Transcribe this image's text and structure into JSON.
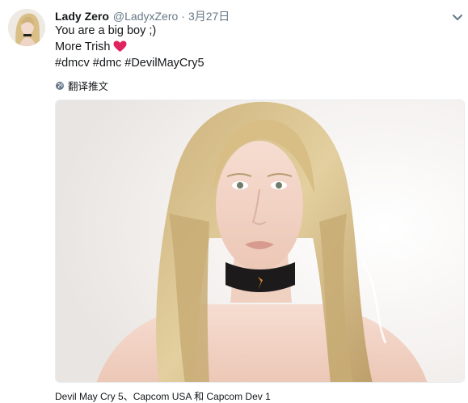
{
  "tweet": {
    "display_name": "Lady Zero",
    "handle": "@LadyxZero",
    "separator": "·",
    "time": "3月27日",
    "lines": {
      "line1": "You are a big boy ;)",
      "line2": "More Trish"
    },
    "hashtags": [
      "#dmcv",
      "#dmc",
      "#DevilMayCry5"
    ],
    "translate_label": "翻译推文",
    "photo_tags": {
      "tag1": "Devil May Cry 5",
      "sep1": "、",
      "tag2": "Capcom USA",
      "sep2": " 和 ",
      "tag3": "Capcom Dev 1"
    }
  },
  "colors": {
    "text": "#14171a",
    "muted": "#657786",
    "heart": "#e0245e",
    "border": "#e6ecf0"
  },
  "icons": {
    "caret": "chevron-down-icon",
    "heart": "heart-emoji-icon",
    "translate": "globe-icon"
  }
}
